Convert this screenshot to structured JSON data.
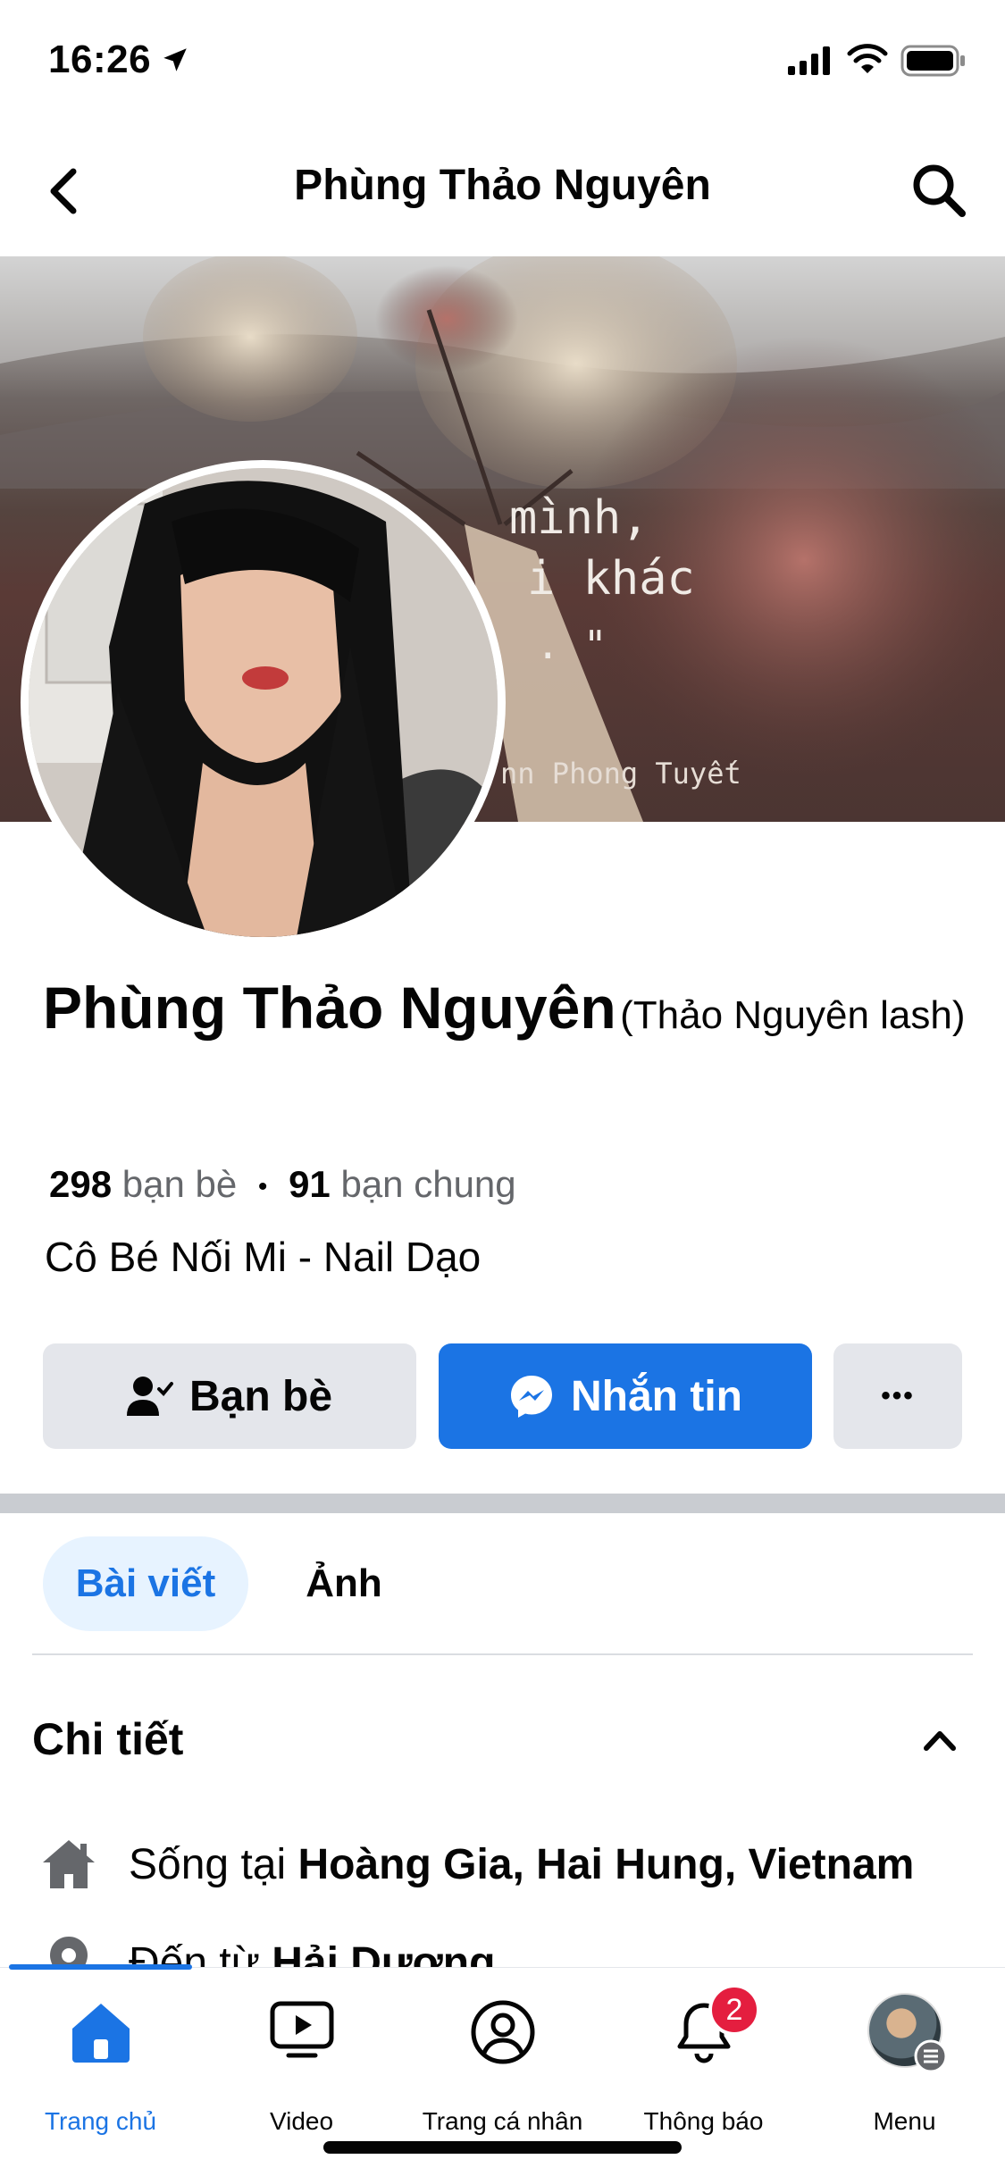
{
  "status_bar": {
    "time": "16:26"
  },
  "header": {
    "title": "Phùng Thảo Nguyên"
  },
  "cover": {
    "quote_lines": [
      "\" Bì        ủa mình,",
      "đ             ời khác",
      "                 . \""
    ],
    "signature": "St                     nn Phong Tuyết"
  },
  "profile": {
    "name": "Phùng Thảo Nguyên",
    "alt_name": "(Thảo Nguyên lash)",
    "friends_count": "298",
    "friends_label": "bạn bè",
    "dot": "•",
    "mutual_count": "91",
    "mutual_label": "bạn chung",
    "bio": "Cô Bé Nối Mi - Nail Dạo"
  },
  "actions": {
    "friends_label": "Bạn bè",
    "message_label": "Nhắn tin",
    "more_label": "•••"
  },
  "tabs": [
    {
      "label": "Bài viết"
    },
    {
      "label": "Ảnh"
    }
  ],
  "details": {
    "title": "Chi tiết",
    "lives_prefix": "Sống tại ",
    "lives_value": "Hoàng Gia, Hai Hung, Vietnam",
    "from_prefix": "Đến từ ",
    "from_value": "Hải Dương"
  },
  "bottom_nav": [
    {
      "label": "Trang chủ",
      "icon": "home-icon"
    },
    {
      "label": "Video",
      "icon": "video-icon"
    },
    {
      "label": "Trang cá nhân",
      "icon": "profile-icon"
    },
    {
      "label": "Thông báo",
      "icon": "bell-icon",
      "badge": "2"
    },
    {
      "label": "Menu",
      "icon": "menu-avatar"
    }
  ],
  "colors": {
    "accent": "#1b74e4",
    "badge": "#e41e3f",
    "muted": "#65676b"
  }
}
